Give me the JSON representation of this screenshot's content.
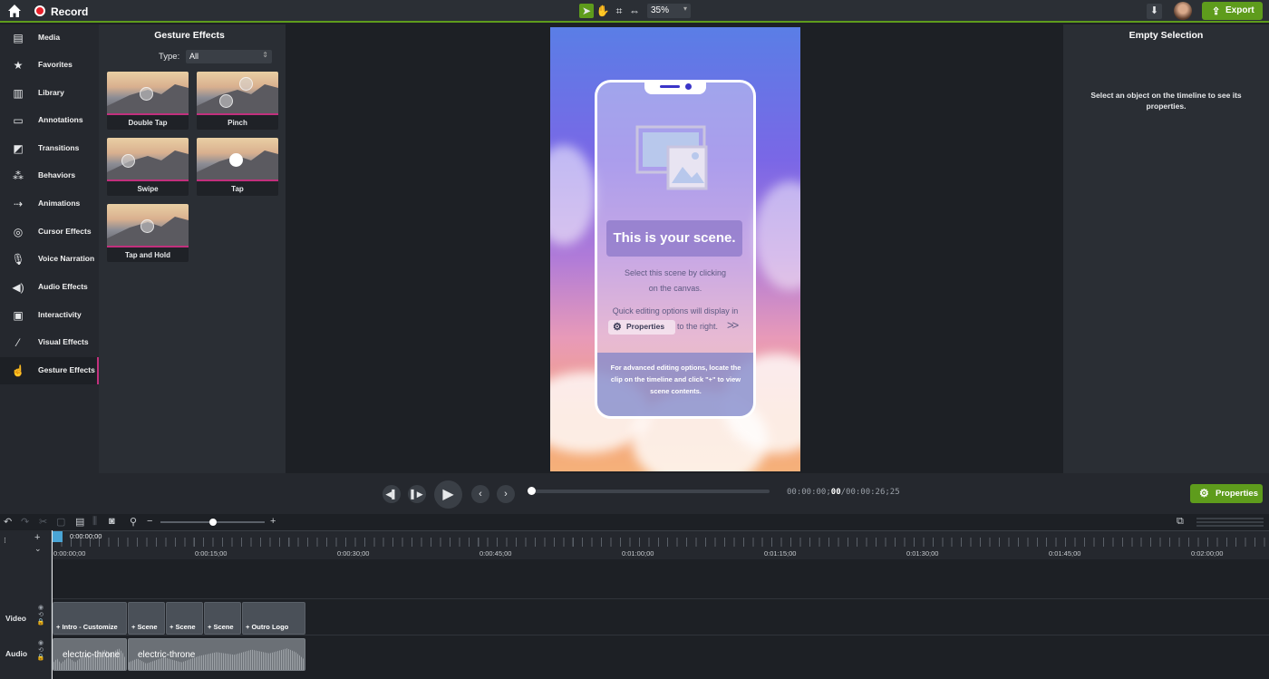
{
  "topbar": {
    "record_label": "Record",
    "zoom": "35%",
    "export_label": "Export",
    "colors": {
      "accent": "#5e9c1c",
      "record": "#e8202a"
    }
  },
  "sidebar": {
    "items": [
      {
        "label": "Media",
        "icon": "film-icon"
      },
      {
        "label": "Favorites",
        "icon": "star-icon"
      },
      {
        "label": "Library",
        "icon": "library-icon"
      },
      {
        "label": "Annotations",
        "icon": "annotation-icon"
      },
      {
        "label": "Transitions",
        "icon": "transition-icon"
      },
      {
        "label": "Behaviors",
        "icon": "behavior-icon"
      },
      {
        "label": "Animations",
        "icon": "animation-icon"
      },
      {
        "label": "Cursor Effects",
        "icon": "cursor-icon"
      },
      {
        "label": "Voice Narration",
        "icon": "microphone-icon"
      },
      {
        "label": "Audio Effects",
        "icon": "speaker-icon"
      },
      {
        "label": "Interactivity",
        "icon": "interactivity-icon"
      },
      {
        "label": "Visual Effects",
        "icon": "wand-icon"
      },
      {
        "label": "Gesture Effects",
        "icon": "hand-pointer-icon",
        "active": true
      }
    ]
  },
  "gesture_panel": {
    "title": "Gesture Effects",
    "type_label": "Type:",
    "type_value": "All",
    "items": [
      {
        "label": "Double Tap"
      },
      {
        "label": "Pinch"
      },
      {
        "label": "Swipe"
      },
      {
        "label": "Tap"
      },
      {
        "label": "Tap and Hold"
      }
    ]
  },
  "scene": {
    "title": "This is your scene.",
    "line1": "Select this scene by clicking",
    "line2": "on the canvas.",
    "line3": "Quick editing options will display in",
    "props_pill": "Properties",
    "to_right": "to the right.",
    "chevrons": ">>",
    "advanced": "For advanced editing options, locate the clip on the timeline and click \"+\" to view scene contents."
  },
  "right_panel": {
    "title": "Empty Selection",
    "message": "Select an object on the timeline to see its properties."
  },
  "playback": {
    "timecode_prefix": "00:00:00;",
    "timecode_frames": "00",
    "timecode_total": "/00:00:26;25",
    "progress": 0,
    "properties_label": "Properties"
  },
  "timeline": {
    "playhead_time": "0:00:00;00",
    "ruler_labels": [
      "0:00:00;00",
      "0:00:15;00",
      "0:00:30;00",
      "0:00:45;00",
      "0:01:00;00",
      "0:01:15;00",
      "0:01:30;00",
      "0:01:45;00",
      "0:02:00;00"
    ],
    "tracks": {
      "video": "Video",
      "audio": "Audio"
    },
    "video_clips": [
      "+ Intro - Customize",
      "+ Scene",
      "+ Scene",
      "+ Scene",
      "+ Outro Logo"
    ],
    "audio_clips": [
      "electric-throne",
      "electric-throne"
    ]
  }
}
